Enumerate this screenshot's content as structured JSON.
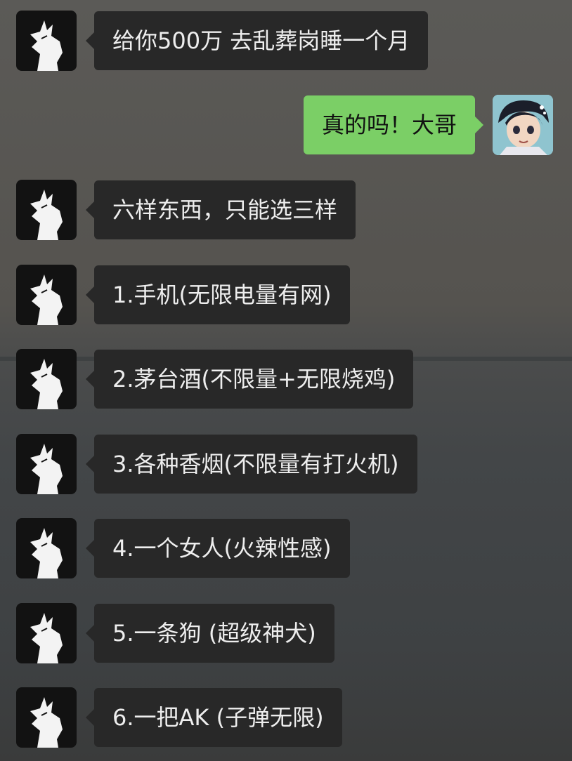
{
  "chat": {
    "messages": [
      {
        "side": "in",
        "text": "给你500万 去乱葬岗睡一个月"
      },
      {
        "side": "out",
        "text": "真的吗！大哥"
      },
      {
        "side": "in",
        "text": "六样东西，只能选三样"
      },
      {
        "side": "in",
        "text": "1.手机(无限电量有网)"
      },
      {
        "side": "in",
        "text": "2.茅台酒(不限量+无限烧鸡)"
      },
      {
        "side": "in",
        "text": "3.各种香烟(不限量有打火机)"
      },
      {
        "side": "in",
        "text": "4.一个女人(火辣性感)"
      },
      {
        "side": "in",
        "text": "5.一条狗 (超级神犬)"
      },
      {
        "side": "in",
        "text": "6.一把AK (子弹无限)"
      }
    ]
  },
  "icons": {
    "sender_avatar": "white-wolf-silhouette-avatar",
    "my_avatar": "anime-boy-avatar"
  },
  "colors": {
    "incoming_bubble": "#282828",
    "outgoing_bubble": "#7bcf66",
    "incoming_text": "#eeeeee",
    "outgoing_text": "#111111"
  }
}
